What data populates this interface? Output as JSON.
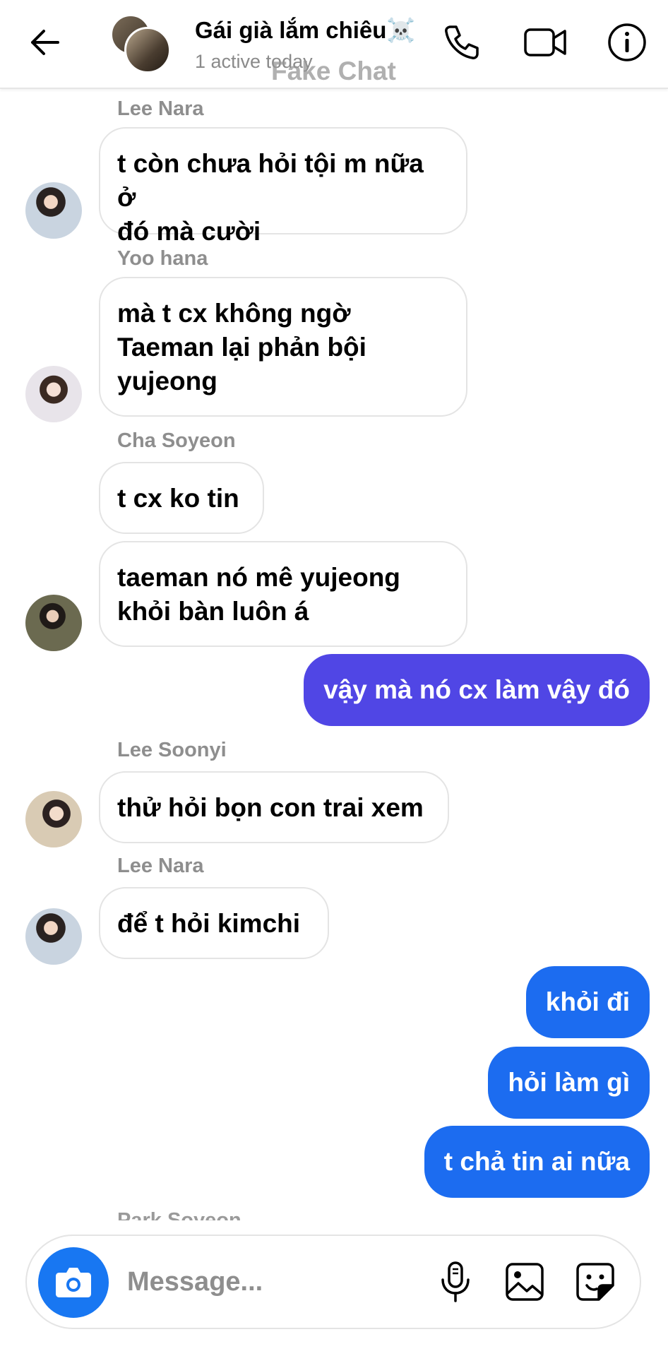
{
  "header": {
    "title": "Gái già lắm chiêu☠️",
    "subtitle": "1 active today",
    "watermark": "Fake Chat"
  },
  "messages": [
    {
      "sender": "Lee Nara",
      "lines": [
        "t còn chưa hỏi tội m nữa ở",
        "đó mà cười"
      ]
    },
    {
      "sender": "Yoo hana",
      "lines": [
        "mà t cx không ngờ",
        "Taeman lại phản bội",
        "yujeong"
      ]
    },
    {
      "sender": "Cha Soyeon",
      "lines": [
        "t cx ko tin"
      ]
    },
    {
      "lines": [
        "taeman nó mê yujeong",
        "khỏi bàn luôn á"
      ]
    },
    {
      "outgoing": "vậy mà nó cx làm vậy đó"
    },
    {
      "sender": "Lee Soonyi",
      "lines": [
        "thử hỏi bọn con trai xem"
      ]
    },
    {
      "sender": "Lee Nara",
      "lines": [
        "để t hỏi kimchi"
      ]
    },
    {
      "outgoing": "khỏi đi"
    },
    {
      "outgoing": "hỏi làm gì"
    },
    {
      "outgoing": "t chả tin ai nữa"
    },
    {
      "sender": "Park Soyeon"
    }
  ],
  "composer": {
    "placeholder": "Message..."
  },
  "colors": {
    "outgoing_purple": "#5046e5",
    "outgoing_blue": "#1c6cf0",
    "camera_blue": "#1877f2",
    "sender_gray": "#8e8e8e"
  },
  "icons": [
    "back-arrow-icon",
    "phone-icon",
    "video-camera-icon",
    "info-icon",
    "camera-icon",
    "microphone-icon",
    "image-icon",
    "sticker-icon"
  ]
}
